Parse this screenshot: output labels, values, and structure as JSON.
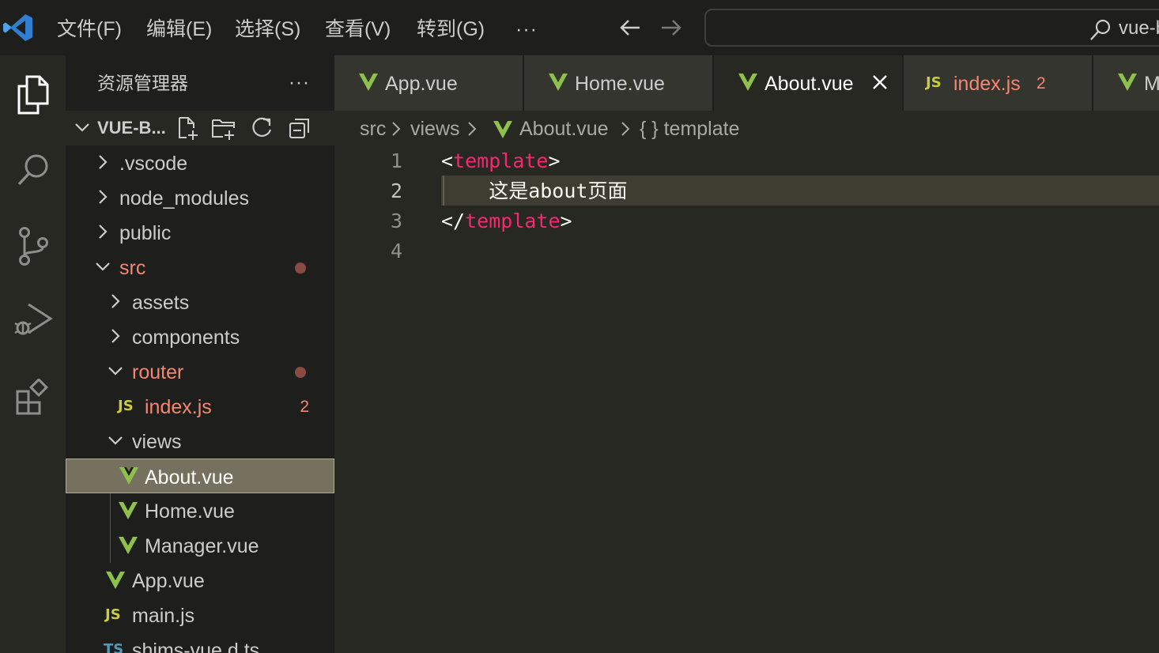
{
  "titlebar": {
    "menus": [
      "文件(F)",
      "编辑(E)",
      "选择(S)",
      "查看(V)",
      "转到(G)",
      "···"
    ],
    "command_center_text": "vue-b"
  },
  "sidebar": {
    "title": "资源管理器",
    "more": "···",
    "project": "VUE-B...",
    "tree": [
      {
        "label": ".vscode",
        "type": "folder",
        "expanded": false
      },
      {
        "label": "node_modules",
        "type": "folder",
        "expanded": false
      },
      {
        "label": "public",
        "type": "folder",
        "expanded": false
      },
      {
        "label": "src",
        "type": "folder",
        "expanded": true,
        "modified": true
      },
      {
        "label": "assets",
        "type": "folder",
        "expanded": false
      },
      {
        "label": "components",
        "type": "folder",
        "expanded": false
      },
      {
        "label": "router",
        "type": "folder",
        "expanded": true,
        "modified": true
      },
      {
        "label": "index.js",
        "type": "js",
        "badge": "2",
        "icon_text": "JS"
      },
      {
        "label": "views",
        "type": "folder",
        "expanded": true
      },
      {
        "label": "About.vue",
        "type": "vue",
        "selected": true
      },
      {
        "label": "Home.vue",
        "type": "vue"
      },
      {
        "label": "Manager.vue",
        "type": "vue"
      },
      {
        "label": "App.vue",
        "type": "vue"
      },
      {
        "label": "main.js",
        "type": "js",
        "icon_text": "JS"
      },
      {
        "label": "shims-vue.d.ts",
        "type": "ts",
        "icon_text": "TS"
      }
    ]
  },
  "tabs": [
    {
      "label": "App.vue",
      "type": "vue"
    },
    {
      "label": "Home.vue",
      "type": "vue"
    },
    {
      "label": "About.vue",
      "type": "vue",
      "active": true
    },
    {
      "label": "index.js",
      "type": "js",
      "badge": "2",
      "icon_text": "JS"
    },
    {
      "label": "M",
      "type": "vue"
    }
  ],
  "breadcrumb": [
    "src",
    "views",
    "About.vue",
    "{ } template"
  ],
  "editor": {
    "line_numbers": [
      "1",
      "2",
      "3",
      "4"
    ],
    "lines": {
      "l1_open": "<",
      "l1_tag": "template",
      "l1_close": ">",
      "l2_text": "    这是about页面",
      "l3_open": "</",
      "l3_tag": "template",
      "l3_close": ">"
    }
  },
  "colors": {
    "vue": "#8dc149",
    "js": "#cbcb41",
    "ts": "#519aba",
    "tag": "#f92672",
    "modified": "#f48771",
    "selection": "#75715e"
  }
}
